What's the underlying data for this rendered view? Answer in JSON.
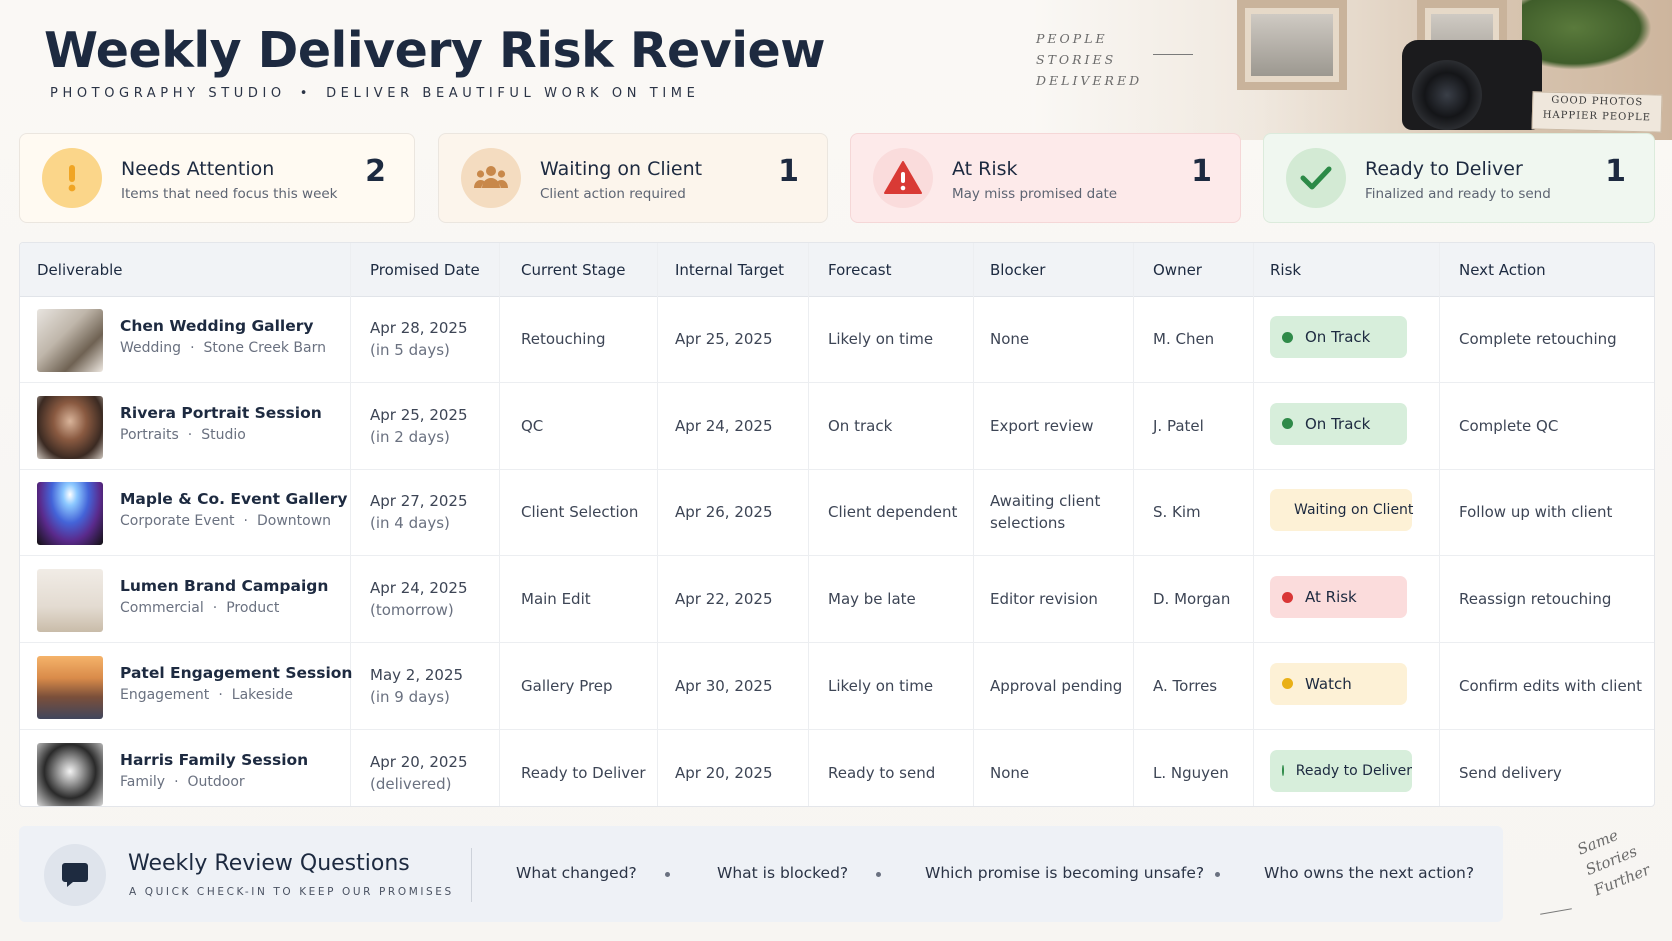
{
  "header": {
    "title": "Weekly Delivery Risk Review",
    "subtitle_left": "PHOTOGRAPHY STUDIO",
    "subtitle_sep": "•",
    "subtitle_right": "DELIVER BEAUTIFUL WORK ON TIME",
    "tagline": [
      "PEOPLE",
      "STORIES",
      "DELIVERED"
    ],
    "book_lines": [
      "GOOD PHOTOS",
      "HAPPIER PEOPLE"
    ]
  },
  "summary": [
    {
      "title": "Needs Attention",
      "subtitle": "Items that need focus this week",
      "count": "2",
      "icon": "exclamation-icon",
      "color": "#f0a524"
    },
    {
      "title": "Waiting on Client",
      "subtitle": "Client action required",
      "count": "1",
      "icon": "users-icon",
      "color": "#c8884a"
    },
    {
      "title": "At Risk",
      "subtitle": "May miss promised date",
      "count": "1",
      "icon": "warning-icon",
      "color": "#d93a35"
    },
    {
      "title": "Ready to Deliver",
      "subtitle": "Finalized and ready to send",
      "count": "1",
      "icon": "check-icon",
      "color": "#2c8a47"
    }
  ],
  "table": {
    "columns": [
      "Deliverable",
      "Promised Date",
      "Current Stage",
      "Internal Target",
      "Forecast",
      "Blocker",
      "Owner",
      "Risk",
      "Next Action"
    ],
    "rows": [
      {
        "name": "Chen Wedding Gallery",
        "type": "Wedding",
        "location": "Stone Creek Barn",
        "promised": "Apr 28, 2025",
        "promised_note": "(in 5 days)",
        "stage": "Retouching",
        "target": "Apr 25, 2025",
        "forecast": "Likely on time",
        "blocker": [
          "None"
        ],
        "owner": "M. Chen",
        "risk": "On Track",
        "risk_level": "green",
        "next": "Complete retouching",
        "thumb": "wedding-photo"
      },
      {
        "name": "Rivera Portrait Session",
        "type": "Portraits",
        "location": "Studio",
        "promised": "Apr 25, 2025",
        "promised_note": "(in 2 days)",
        "stage": "QC",
        "target": "Apr 24, 2025",
        "forecast": "On track",
        "blocker": [
          "Export review"
        ],
        "owner": "J. Patel",
        "risk": "On Track",
        "risk_level": "green",
        "next": "Complete QC",
        "thumb": "portrait-photo"
      },
      {
        "name": "Maple & Co. Event Gallery",
        "type": "Corporate Event",
        "location": "Downtown",
        "promised": "Apr 27, 2025",
        "promised_note": "(in 4 days)",
        "stage": "Client Selection",
        "target": "Apr 26, 2025",
        "forecast": "Client dependent",
        "blocker": [
          "Awaiting client",
          "selections"
        ],
        "owner": "S. Kim",
        "risk": "Waiting on Client",
        "risk_level": "yellow",
        "next": "Follow up with client",
        "thumb": "event-photo"
      },
      {
        "name": "Lumen Brand Campaign",
        "type": "Commercial",
        "location": "Product",
        "promised": "Apr 24, 2025",
        "promised_note": "(tomorrow)",
        "stage": "Main Edit",
        "target": "Apr 22, 2025",
        "forecast": "May be late",
        "blocker": [
          "Editor revision"
        ],
        "owner": "D. Morgan",
        "risk": "At Risk",
        "risk_level": "red",
        "next": "Reassign retouching",
        "thumb": "product-photo"
      },
      {
        "name": "Patel Engagement Session",
        "type": "Engagement",
        "location": "Lakeside",
        "promised": "May 2, 2025",
        "promised_note": "(in 9 days)",
        "stage": "Gallery Prep",
        "target": "Apr 30, 2025",
        "forecast": "Likely on time",
        "blocker": [
          "Approval pending"
        ],
        "owner": "A. Torres",
        "risk": "Watch",
        "risk_level": "yellow",
        "next": "Confirm edits with client",
        "thumb": "engagement-photo"
      },
      {
        "name": "Harris Family Session",
        "type": "Family",
        "location": "Outdoor",
        "promised": "Apr 20, 2025",
        "promised_note": "(delivered)",
        "stage": "Ready to Deliver",
        "target": "Apr 20, 2025",
        "forecast": "Ready to send",
        "blocker": [
          "None"
        ],
        "owner": "L. Nguyen",
        "risk": "Ready to Deliver",
        "risk_level": "green",
        "next": "Send delivery",
        "thumb": "dog-photo"
      }
    ]
  },
  "footer": {
    "title": "Weekly Review Questions",
    "subtitle": "A QUICK CHECK-IN TO KEEP OUR PROMISES",
    "questions": [
      "What changed?",
      "What is blocked?",
      "Which promise is becoming unsafe?",
      "Who owns the next action?"
    ],
    "script": [
      "Same",
      "Stories",
      "Further"
    ]
  }
}
